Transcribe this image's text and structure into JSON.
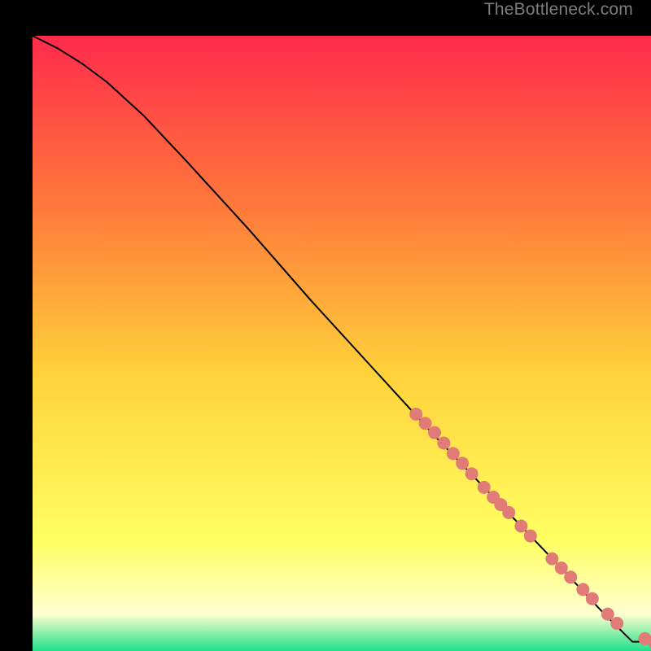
{
  "attribution": "TheBottleneck.com",
  "colors": {
    "bg_top": "#ff2a4b",
    "bg_mid_upper": "#ff7a3a",
    "bg_mid": "#ffd23a",
    "bg_mid_lower": "#ffff62",
    "bg_pale": "#ffffd0",
    "bg_green": "#1fe08a",
    "line": "#000000",
    "marker_fill": "#e07b78",
    "marker_stroke": "#e07b78"
  },
  "chart_data": {
    "type": "line",
    "title": "",
    "xlabel": "",
    "ylabel": "",
    "xlim": [
      0,
      100
    ],
    "ylim": [
      0,
      100
    ],
    "grid": false,
    "legend": false,
    "curve": [
      {
        "x": 0,
        "y": 100
      },
      {
        "x": 4,
        "y": 98
      },
      {
        "x": 8,
        "y": 95.5
      },
      {
        "x": 12,
        "y": 92.5
      },
      {
        "x": 18,
        "y": 87
      },
      {
        "x": 25,
        "y": 79.5
      },
      {
        "x": 35,
        "y": 68.5
      },
      {
        "x": 45,
        "y": 57
      },
      {
        "x": 55,
        "y": 46
      },
      {
        "x": 65,
        "y": 35
      },
      {
        "x": 75,
        "y": 24.5
      },
      {
        "x": 85,
        "y": 14
      },
      {
        "x": 92,
        "y": 6.5
      },
      {
        "x": 97,
        "y": 1.5
      },
      {
        "x": 100,
        "y": 1.5
      }
    ],
    "markers_cluster_top": [
      {
        "x": 62,
        "y": 38.5
      },
      {
        "x": 63.5,
        "y": 37
      },
      {
        "x": 65,
        "y": 35.5
      },
      {
        "x": 66.5,
        "y": 33.8
      },
      {
        "x": 68,
        "y": 32.1
      },
      {
        "x": 69.5,
        "y": 30.5
      },
      {
        "x": 71,
        "y": 28.8
      },
      {
        "x": 73,
        "y": 26.6
      },
      {
        "x": 74.5,
        "y": 25
      },
      {
        "x": 75.7,
        "y": 23.8
      },
      {
        "x": 77,
        "y": 22.5
      },
      {
        "x": 79,
        "y": 20.3
      },
      {
        "x": 80.5,
        "y": 18.7
      }
    ],
    "markers_cluster_bottom": [
      {
        "x": 84,
        "y": 15
      },
      {
        "x": 85.5,
        "y": 13.5
      },
      {
        "x": 87,
        "y": 12
      },
      {
        "x": 89,
        "y": 10
      },
      {
        "x": 90.5,
        "y": 8.5
      },
      {
        "x": 93,
        "y": 6
      },
      {
        "x": 94.5,
        "y": 4.5
      },
      {
        "x": 99,
        "y": 2
      },
      {
        "x": 100.5,
        "y": 1.5
      }
    ],
    "marker_radius_px": 8
  }
}
